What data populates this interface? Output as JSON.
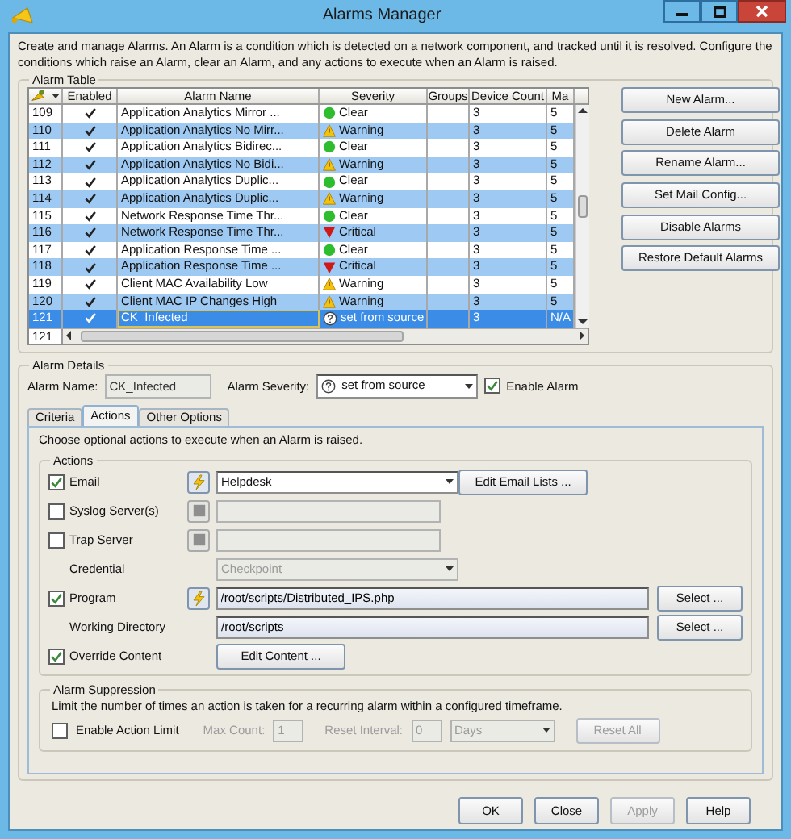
{
  "window": {
    "title": "Alarms Manager"
  },
  "description": "Create and manage Alarms. An Alarm is a condition which is detected on a network component, and tracked until it is resolved. Configure the conditions which raise an Alarm, clear an Alarm, and any actions to execute when an Alarm is raised.",
  "alarm_table": {
    "legend": "Alarm Table",
    "columns": [
      "Enabled",
      "Alarm Name",
      "Severity",
      "Groups",
      "Device Count",
      "Ma"
    ],
    "rows": [
      {
        "id": "109",
        "enabled": true,
        "name": "Application Analytics Mirror ...",
        "severity": {
          "kind": "clear",
          "label": "Clear"
        },
        "device_count": "3",
        "max": "5",
        "selected": false
      },
      {
        "id": "110",
        "enabled": true,
        "name": "Application Analytics No Mirr...",
        "severity": {
          "kind": "warning",
          "label": "Warning"
        },
        "device_count": "3",
        "max": "5",
        "selected": false
      },
      {
        "id": "111",
        "enabled": true,
        "name": "Application Analytics Bidirec...",
        "severity": {
          "kind": "clear",
          "label": "Clear"
        },
        "device_count": "3",
        "max": "5",
        "selected": false
      },
      {
        "id": "112",
        "enabled": true,
        "name": "Application Analytics No Bidi...",
        "severity": {
          "kind": "warning",
          "label": "Warning"
        },
        "device_count": "3",
        "max": "5",
        "selected": false
      },
      {
        "id": "113",
        "enabled": true,
        "name": "Application Analytics Duplic...",
        "severity": {
          "kind": "clear",
          "label": "Clear"
        },
        "device_count": "3",
        "max": "5",
        "selected": false
      },
      {
        "id": "114",
        "enabled": true,
        "name": "Application Analytics Duplic...",
        "severity": {
          "kind": "warning",
          "label": "Warning"
        },
        "device_count": "3",
        "max": "5",
        "selected": false
      },
      {
        "id": "115",
        "enabled": true,
        "name": "Network Response Time Thr...",
        "severity": {
          "kind": "clear",
          "label": "Clear"
        },
        "device_count": "3",
        "max": "5",
        "selected": false
      },
      {
        "id": "116",
        "enabled": true,
        "name": "Network Response Time Thr...",
        "severity": {
          "kind": "critical",
          "label": "Critical"
        },
        "device_count": "3",
        "max": "5",
        "selected": false
      },
      {
        "id": "117",
        "enabled": true,
        "name": "Application Response Time ...",
        "severity": {
          "kind": "clear",
          "label": "Clear"
        },
        "device_count": "3",
        "max": "5",
        "selected": false
      },
      {
        "id": "118",
        "enabled": true,
        "name": "Application Response Time ...",
        "severity": {
          "kind": "critical",
          "label": "Critical"
        },
        "device_count": "3",
        "max": "5",
        "selected": false
      },
      {
        "id": "119",
        "enabled": true,
        "name": "Client MAC Availability Low",
        "severity": {
          "kind": "warning",
          "label": "Warning"
        },
        "device_count": "3",
        "max": "5",
        "selected": false
      },
      {
        "id": "120",
        "enabled": true,
        "name": "Client MAC IP Changes High",
        "severity": {
          "kind": "warning",
          "label": "Warning"
        },
        "device_count": "3",
        "max": "5",
        "selected": false
      },
      {
        "id": "121",
        "enabled": true,
        "name": "CK_Infected",
        "severity": {
          "kind": "unknown",
          "label": "set from source"
        },
        "device_count": "3",
        "max": "N/A",
        "selected": true
      }
    ],
    "edit_row": "121"
  },
  "table_buttons": [
    "New Alarm...",
    "Delete Alarm",
    "Rename Alarm...",
    "Set Mail Config...",
    "Disable Alarms",
    "Restore Default Alarms"
  ],
  "alarm_details": {
    "legend": "Alarm Details",
    "name_label": "Alarm Name:",
    "name_value": "CK_Infected",
    "severity_label": "Alarm Severity:",
    "severity_value": {
      "kind": "unknown",
      "label": "set from source"
    },
    "enable": {
      "label": "Enable Alarm",
      "checked": true
    }
  },
  "tabs": [
    {
      "label": "Criteria",
      "selected": false
    },
    {
      "label": "Actions",
      "selected": true
    },
    {
      "label": "Other Options",
      "selected": false
    }
  ],
  "actions_intro": "Choose optional actions to execute when an Alarm is raised.",
  "actions": {
    "legend": "Actions",
    "email": {
      "label": "Email",
      "checked": true,
      "value": "Helpdesk",
      "button": "Edit Email Lists ..."
    },
    "syslog": {
      "label": "Syslog Server(s)",
      "checked": false
    },
    "trap": {
      "label": "Trap Server",
      "checked": false
    },
    "credential": {
      "label": "Credential",
      "value": "Checkpoint",
      "disabled": true
    },
    "program": {
      "label": "Program",
      "checked": true,
      "value": "/root/scripts/Distributed_IPS.php",
      "button": "Select ..."
    },
    "working_directory": {
      "label": "Working Directory",
      "value": "/root/scripts",
      "button": "Select ..."
    },
    "override": {
      "label": "Override Content",
      "checked": true,
      "button": "Edit Content ..."
    }
  },
  "suppression": {
    "legend": "Alarm Suppression",
    "text": "Limit the number of times an action is taken for a recurring alarm within a configured timeframe.",
    "limit": {
      "label": "Enable Action Limit",
      "checked": false
    },
    "max_count_label": "Max Count:",
    "max_count": "1",
    "reset_interval_label": "Reset Interval:",
    "reset_interval": "0",
    "unit": "Days",
    "reset_button": "Reset All"
  },
  "footer_buttons": [
    {
      "label": "OK",
      "disabled": false
    },
    {
      "label": "Close",
      "disabled": false
    },
    {
      "label": "Apply",
      "disabled": true
    },
    {
      "label": "Help",
      "disabled": false
    }
  ]
}
